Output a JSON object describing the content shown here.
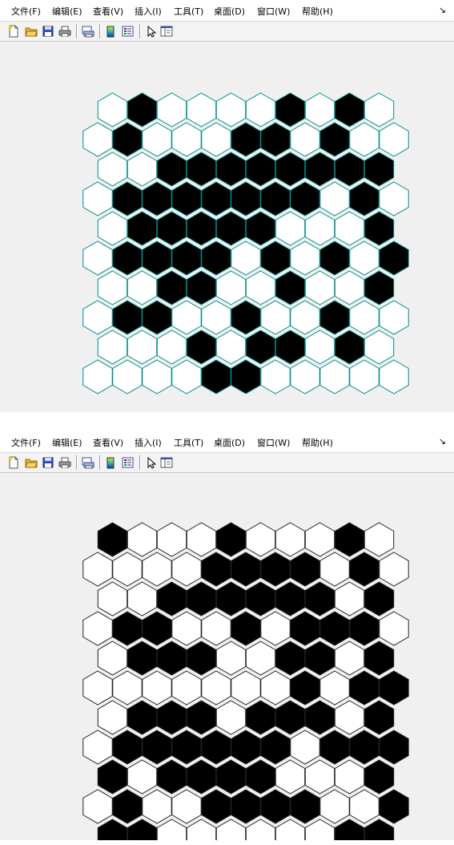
{
  "menu": [
    {
      "label": "文件(F)"
    },
    {
      "label": "编辑(E)"
    },
    {
      "label": "查看(V)"
    },
    {
      "label": "插入(I)"
    },
    {
      "label": "工具(T)"
    },
    {
      "label": "桌面(D)"
    },
    {
      "label": "窗口(W)"
    },
    {
      "label": "帮助(H)"
    }
  ],
  "menu_arrow": "↘",
  "toolbar_icons": [
    "new-file-icon",
    "open-folder-icon",
    "save-icon",
    "print-icon",
    "print-preview-icon",
    "colorbar-icon",
    "legend-icon",
    "select-arrow-icon",
    "property-editor-icon"
  ],
  "colors": {
    "hex_white": "#ffffff",
    "hex_black": "#000000",
    "edge_top": "#008b8b",
    "edge_bottom": "#222222"
  },
  "boards": {
    "top": [
      "0100001010",
      "01000110100",
      "0011111111",
      "01111111010",
      "0111110001",
      "01111010101",
      "0011001001",
      "01100100100",
      "0001011010",
      "00001100000"
    ],
    "bottom": [
      "1000100010",
      "00001111010",
      "0011111101",
      "01100101110",
      "0111001101",
      "00000001011",
      "0111011101",
      "01111110111",
      "1011110001",
      "01001111001",
      "1100000011"
    ]
  }
}
